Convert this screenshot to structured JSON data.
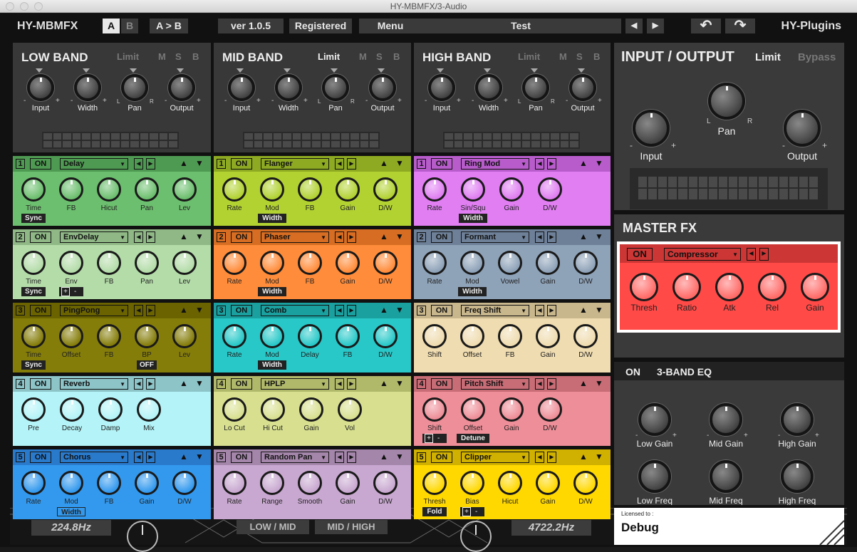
{
  "window": {
    "title": "HY-MBMFX/3-Audio"
  },
  "topbar": {
    "brand": "HY-MBMFX",
    "ab": {
      "a": "A",
      "b": "B"
    },
    "copy": "A > B",
    "version": "ver 1.0.5",
    "registered": "Registered",
    "menu": "Menu",
    "preset": "Test",
    "prev": "◀",
    "next": "▶",
    "undo": "↶",
    "redo": "↷",
    "vendor": "HY-Plugins"
  },
  "bands": [
    {
      "title": "LOW BAND",
      "limit": "Limit",
      "limit_active": false,
      "m": "M",
      "s": "S",
      "b": "B",
      "knobs": [
        "Input",
        "Width",
        "Pan",
        "Output"
      ],
      "pan_l": "L",
      "pan_r": "R",
      "minus": "-",
      "plus": "+"
    },
    {
      "title": "MID BAND",
      "limit": "Limit",
      "limit_active": true,
      "m": "M",
      "s": "S",
      "b": "B",
      "knobs": [
        "Input",
        "Width",
        "Pan",
        "Output"
      ],
      "pan_l": "L",
      "pan_r": "R",
      "minus": "-",
      "plus": "+"
    },
    {
      "title": "HIGH BAND",
      "limit": "Limit",
      "limit_active": false,
      "m": "M",
      "s": "S",
      "b": "B",
      "knobs": [
        "Input",
        "Width",
        "Pan",
        "Output"
      ],
      "pan_l": "L",
      "pan_r": "R",
      "minus": "-",
      "plus": "+"
    }
  ],
  "slots": [
    [
      {
        "num": "1",
        "on": "ON",
        "fx": "Delay",
        "color": "#6cbf6e",
        "hdr": "#4f9a52",
        "knobs": [
          "Time",
          "FB",
          "Hicut",
          "Pan",
          "Lev"
        ],
        "tags": [
          {
            "label": "Sync",
            "k": 0
          }
        ]
      },
      {
        "num": "2",
        "on": "ON",
        "fx": "EnvDelay",
        "color": "#b4dca9",
        "hdr": "#8fb886",
        "knobs": [
          "Time",
          "Env",
          "FB",
          "Pan",
          "Lev"
        ],
        "tags": [
          {
            "label": "Sync",
            "k": 0
          }
        ],
        "pm": {
          "k": 1,
          "plus": "+",
          "minus": "-"
        }
      },
      {
        "num": "3",
        "on": "ON",
        "fx": "PingPong",
        "color": "#857d0a",
        "hdr": "#6a6300",
        "knobs": [
          "Time",
          "Offset",
          "FB",
          "BP",
          "Lev"
        ],
        "tags": [
          {
            "label": "Sync",
            "k": 0
          },
          {
            "label": "OFF",
            "k": 3
          }
        ]
      },
      {
        "num": "4",
        "on": "ON",
        "fx": "Reverb",
        "color": "#b4f4f8",
        "hdr": "#8cc4c8",
        "knobs": [
          "Pre",
          "Decay",
          "Damp",
          "Mix"
        ],
        "tags": []
      },
      {
        "num": "5",
        "on": "ON",
        "fx": "Chorus",
        "color": "#3399ee",
        "hdr": "#2a7acc",
        "knobs": [
          "Rate",
          "Mod",
          "FB",
          "Gain",
          "D/W"
        ],
        "tags": [
          {
            "label": "Width",
            "k": 1,
            "outline": true
          }
        ]
      }
    ],
    [
      {
        "num": "1",
        "on": "ON",
        "fx": "Flanger",
        "color": "#b2d232",
        "hdr": "#8daa22",
        "knobs": [
          "Rate",
          "Mod",
          "FB",
          "Gain",
          "D/W"
        ],
        "tags": [
          {
            "label": "Width",
            "k": 1
          }
        ]
      },
      {
        "num": "2",
        "on": "ON",
        "fx": "Phaser",
        "color": "#ff8c3a",
        "hdr": "#d66d22",
        "knobs": [
          "Rate",
          "Mod",
          "FB",
          "Gain",
          "D/W"
        ],
        "tags": [
          {
            "label": "Width",
            "k": 1
          }
        ]
      },
      {
        "num": "3",
        "on": "ON",
        "fx": "Comb",
        "color": "#28c8c8",
        "hdr": "#1ba0a0",
        "knobs": [
          "Rate",
          "Mod",
          "Delay",
          "FB",
          "D/W"
        ],
        "tags": [
          {
            "label": "Width",
            "k": 1
          }
        ]
      },
      {
        "num": "4",
        "on": "ON",
        "fx": "HPLP",
        "color": "#d8e090",
        "hdr": "#b0b86a",
        "knobs": [
          "Lo Cut",
          "Hi Cut",
          "Gain",
          "Vol"
        ],
        "tags": []
      },
      {
        "num": "5",
        "on": "ON",
        "fx": "Random Pan",
        "color": "#c8a8d0",
        "hdr": "#a486aa",
        "knobs": [
          "Rate",
          "Range",
          "Smooth",
          "Gain",
          "D/W"
        ],
        "tags": []
      }
    ],
    [
      {
        "num": "1",
        "on": "ON",
        "fx": "Ring Mod",
        "color": "#e07ef2",
        "hdr": "#b85ccc",
        "knobs": [
          "Rate",
          "Sin/Squ",
          "Gain",
          "D/W"
        ],
        "tags": [
          {
            "label": "Width",
            "k": 1
          }
        ]
      },
      {
        "num": "2",
        "on": "ON",
        "fx": "Formant",
        "color": "#8ea2b8",
        "hdr": "#6e8098",
        "knobs": [
          "Rate",
          "Mod",
          "Vowel",
          "Gain",
          "D/W"
        ],
        "tags": [
          {
            "label": "Width",
            "k": 1
          }
        ]
      },
      {
        "num": "3",
        "on": "ON",
        "fx": "Freq Shift",
        "color": "#efdcb0",
        "hdr": "#c8b68c",
        "knobs": [
          "Shift",
          "Offset",
          "FB",
          "Gain",
          "D/W"
        ],
        "tags": []
      },
      {
        "num": "4",
        "on": "ON",
        "fx": "Pitch Shift",
        "color": "#ee8e98",
        "hdr": "#c86c76",
        "knobs": [
          "Shift",
          "Offset",
          "Gain",
          "D/W"
        ],
        "tags": [
          {
            "label": "Detune",
            "k": 1
          }
        ],
        "pm": {
          "k": 0,
          "plus": "+",
          "minus": "-"
        }
      },
      {
        "num": "5",
        "on": "ON",
        "fx": "Clipper",
        "color": "#ffd800",
        "hdr": "#d0b000",
        "knobs": [
          "Thresh",
          "Bias",
          "Hicut",
          "Gain",
          "D/W"
        ],
        "tags": [
          {
            "label": "Fold",
            "k": 0
          }
        ],
        "pm": {
          "k": 1,
          "plus": "+",
          "minus": "-"
        }
      }
    ]
  ],
  "io": {
    "title": "INPUT / OUTPUT",
    "limit": "Limit",
    "bypass": "Bypass",
    "input": "Input",
    "pan": "Pan",
    "output": "Output",
    "pan_l": "L",
    "pan_r": "R",
    "minus": "-",
    "plus": "+"
  },
  "master": {
    "title": "MASTER FX",
    "on": "ON",
    "fx": "Compressor",
    "knobs": [
      "Thresh",
      "Ratio",
      "Atk",
      "Rel",
      "Gain"
    ]
  },
  "eq": {
    "on": "ON",
    "title": "3-BAND EQ",
    "gains": [
      "Low Gain",
      "Mid Gain",
      "High Gain"
    ],
    "freqs": [
      "Low Freq",
      "Mid Freq",
      "High Freq"
    ],
    "minus": "-",
    "plus": "+"
  },
  "bottom": {
    "low_freq": "224.8Hz",
    "high_freq": "4722.2Hz",
    "low_mid": "LOW / MID",
    "mid_high": "MID / HIGH"
  },
  "license": {
    "label": "Licensed to :",
    "name": "Debug"
  }
}
